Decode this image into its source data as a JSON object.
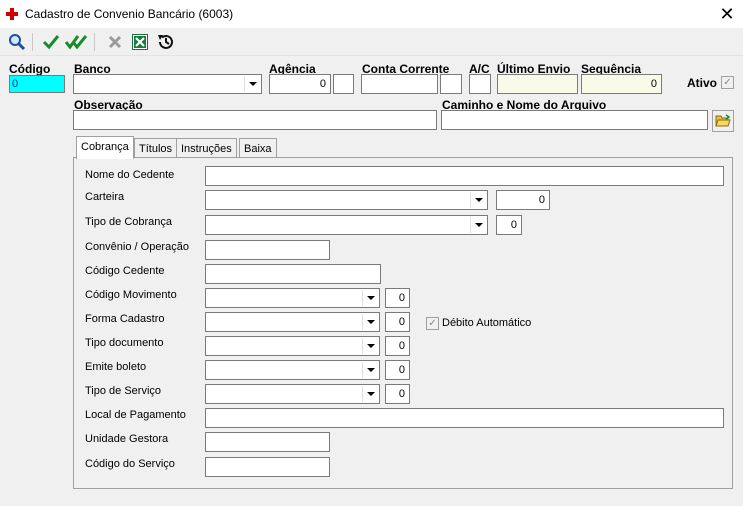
{
  "window": {
    "title": "Cadastro de Convenio Bancário (6003)",
    "close_glyph": "✕"
  },
  "toolbar": {
    "icons": [
      "search-icon",
      "check-icon",
      "double-check-icon",
      "cancel-icon",
      "excel-icon",
      "history-icon"
    ]
  },
  "header": {
    "codigo_label": "Código",
    "codigo_value": "0",
    "banco_label": "Banco",
    "agencia_label": "Agência",
    "agencia_value": "0",
    "conta_label": "Conta Corrente",
    "ac_label": "A/C",
    "ultimo_envio_label": "Último Envio",
    "sequencia_label": "Sequência",
    "sequencia_value": "0",
    "ativo_label": "Ativo",
    "observacao_label": "Observação",
    "caminho_label": "Caminho e Nome do Arquivo"
  },
  "tabs": [
    {
      "label": "Cobrança"
    },
    {
      "label": "Títulos"
    },
    {
      "label": "Instruções"
    },
    {
      "label": "Baixa"
    }
  ],
  "cobranca": {
    "nome_cedente": "Nome do Cedente",
    "carteira": "Carteira",
    "carteira_value": "0",
    "tipo_cobranca": "Tipo de Cobrança",
    "tipo_cobranca_value": "0",
    "convenio": "Convênio / Operação",
    "codigo_cedente": "Código Cedente",
    "codigo_movimento": "Código Movimento",
    "codigo_movimento_value": "0",
    "forma_cadastro": "Forma Cadastro",
    "forma_cadastro_value": "0",
    "tipo_documento": "Tipo documento",
    "tipo_documento_value": "0",
    "emite_boleto": "Emite boleto",
    "emite_boleto_value": "0",
    "tipo_servico": "Tipo de Serviço",
    "tipo_servico_value": "0",
    "local_pagamento": "Local de Pagamento",
    "unidade_gestora": "Unidade Gestora",
    "codigo_servico": "Código do Serviço",
    "debito_automatico": "Débito Automático"
  }
}
